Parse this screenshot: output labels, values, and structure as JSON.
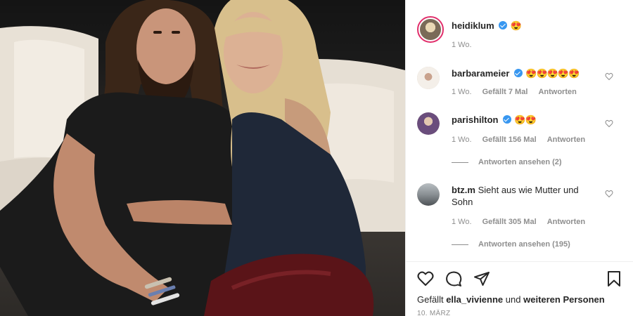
{
  "post": {
    "author": {
      "username": "heidiklum",
      "verified": true,
      "caption_emoji": "😍",
      "time": "1 Wo."
    },
    "comments": [
      {
        "username": "barbarameier",
        "verified": true,
        "text": "😍😍😍😍😍",
        "time": "1 Wo.",
        "likes": "Gefällt 7 Mal",
        "reply": "Antworten"
      },
      {
        "username": "parishilton",
        "verified": true,
        "text": "😍😍",
        "time": "1 Wo.",
        "likes": "Gefällt 156 Mal",
        "reply": "Antworten",
        "view_replies": "Antworten ansehen (2)"
      },
      {
        "username": "btz.m",
        "verified": false,
        "text": "Sieht aus wie Mutter und Sohn",
        "time": "1 Wo.",
        "likes": "Gefällt 305 Mal",
        "reply": "Antworten",
        "view_replies": "Antworten ansehen (195)"
      }
    ],
    "liked_by": {
      "prefix": "Gefällt",
      "user": "ella_vivienne",
      "middle": "und",
      "rest": "weiteren Personen"
    },
    "date": "10. MÄRZ"
  },
  "icons": {
    "like": "heart-outline-icon",
    "comment": "speech-bubble-icon",
    "share": "paper-plane-icon",
    "save": "bookmark-icon",
    "verified": "verified-badge-icon",
    "comment_like": "small-heart-icon"
  },
  "colors": {
    "verified": "#3897f0",
    "story_ring": "#e1306c",
    "secondary_text": "#8e8e8e"
  }
}
